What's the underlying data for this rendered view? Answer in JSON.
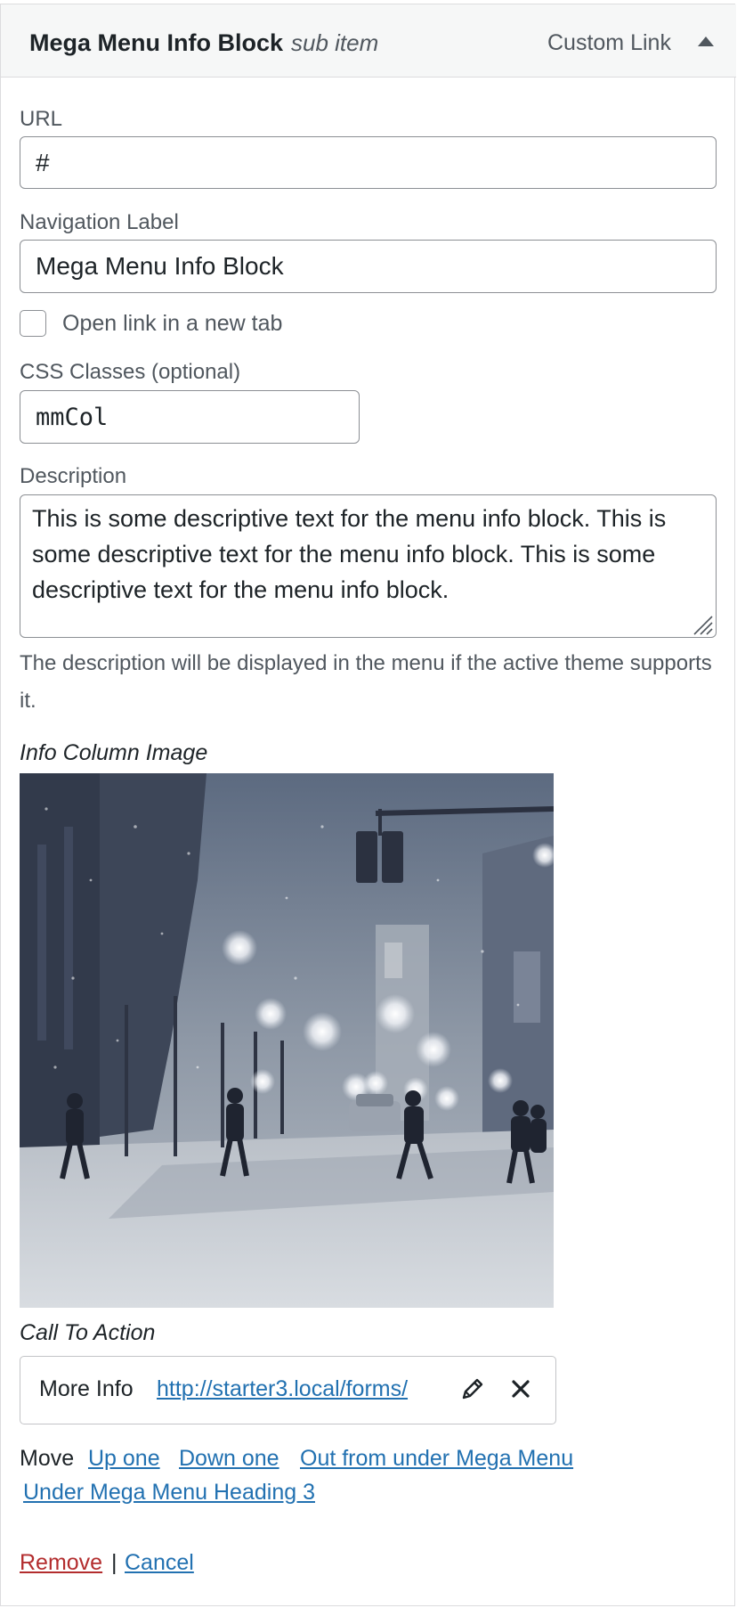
{
  "header": {
    "title": "Mega Menu Info Block",
    "subtitle": "sub item",
    "item_type": "Custom Link",
    "toggle_icon": "triangle-up-icon"
  },
  "fields": {
    "url": {
      "label": "URL",
      "value": "#"
    },
    "nav_label": {
      "label": "Navigation Label",
      "value": "Mega Menu Info Block"
    },
    "new_tab": {
      "label": "Open link in a new tab",
      "checked": false
    },
    "css_classes": {
      "label": "CSS Classes (optional)",
      "value": "mmCol"
    },
    "description": {
      "label": "Description",
      "value": "This is some descriptive text for the menu info block. This is some descriptive text for the menu info block. This is some descriptive text for the menu info block.",
      "help": "The description will be displayed in the menu if the active theme supports it."
    }
  },
  "info_image": {
    "label": "Info Column Image"
  },
  "cta": {
    "label": "Call To Action",
    "title": "More Info",
    "url": "http://starter3.local/forms/",
    "edit_icon": "pencil-icon",
    "remove_icon": "close-icon"
  },
  "move": {
    "label": "Move",
    "up": "Up one",
    "down": "Down one",
    "out": "Out from under Mega Menu",
    "under": "Under Mega Menu Heading 3"
  },
  "actions": {
    "remove": "Remove",
    "separator": "|",
    "cancel": "Cancel"
  },
  "colors": {
    "link": "#2271b1",
    "remove": "#b32d2e",
    "border": "#8c8f94",
    "header_bg": "#f6f7f7"
  }
}
